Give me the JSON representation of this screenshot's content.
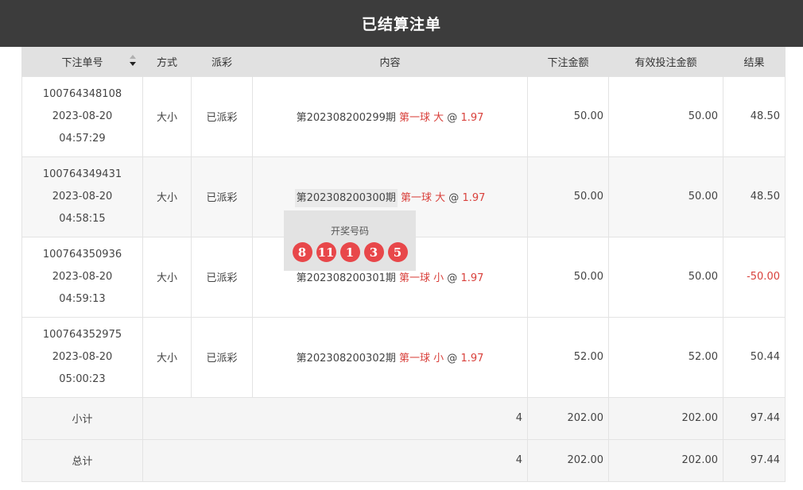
{
  "title": "已结算注单",
  "headers": {
    "order_no": "下注单号",
    "method": "方式",
    "payout": "派彩",
    "content": "内容",
    "bet_amount": "下注金额",
    "valid_amount": "有效投注金额",
    "result": "结果"
  },
  "rows": [
    {
      "order_id": "100764348108",
      "date": "2023-08-20",
      "time": "04:57:29",
      "method": "大小",
      "payout": "已派彩",
      "period": "第202308200299期",
      "pick": "第一球 大",
      "at": "@",
      "odds": "1.97",
      "bet_amount": "50.00",
      "valid_amount": "50.00",
      "result": "48.50"
    },
    {
      "order_id": "100764349431",
      "date": "2023-08-20",
      "time": "04:58:15",
      "method": "大小",
      "payout": "已派彩",
      "period": "第202308200300期",
      "pick": "第一球 大",
      "at": "@",
      "odds": "1.97",
      "bet_amount": "50.00",
      "valid_amount": "50.00",
      "result": "48.50"
    },
    {
      "order_id": "100764350936",
      "date": "2023-08-20",
      "time": "04:59:13",
      "method": "大小",
      "payout": "已派彩",
      "period": "第202308200301期",
      "pick": "第一球 小",
      "at": "@",
      "odds": "1.97",
      "bet_amount": "50.00",
      "valid_amount": "50.00",
      "result": "-50.00"
    },
    {
      "order_id": "100764352975",
      "date": "2023-08-20",
      "time": "05:00:23",
      "method": "大小",
      "payout": "已派彩",
      "period": "第202308200302期",
      "pick": "第一球 小",
      "at": "@",
      "odds": "1.97",
      "bet_amount": "52.00",
      "valid_amount": "52.00",
      "result": "50.44"
    }
  ],
  "subtotal": {
    "label": "小计",
    "count": "4",
    "bet_amount": "202.00",
    "valid_amount": "202.00",
    "result": "97.44"
  },
  "total": {
    "label": "总计",
    "count": "4",
    "bet_amount": "202.00",
    "valid_amount": "202.00",
    "result": "97.44"
  },
  "popup": {
    "title": "开奖号码",
    "balls": [
      "8",
      "11",
      "1",
      "3",
      "5"
    ]
  },
  "colors": {
    "header_bar": "#3c3c3c",
    "accent_red": "#d9413c",
    "ball_red": "#e8474a"
  }
}
